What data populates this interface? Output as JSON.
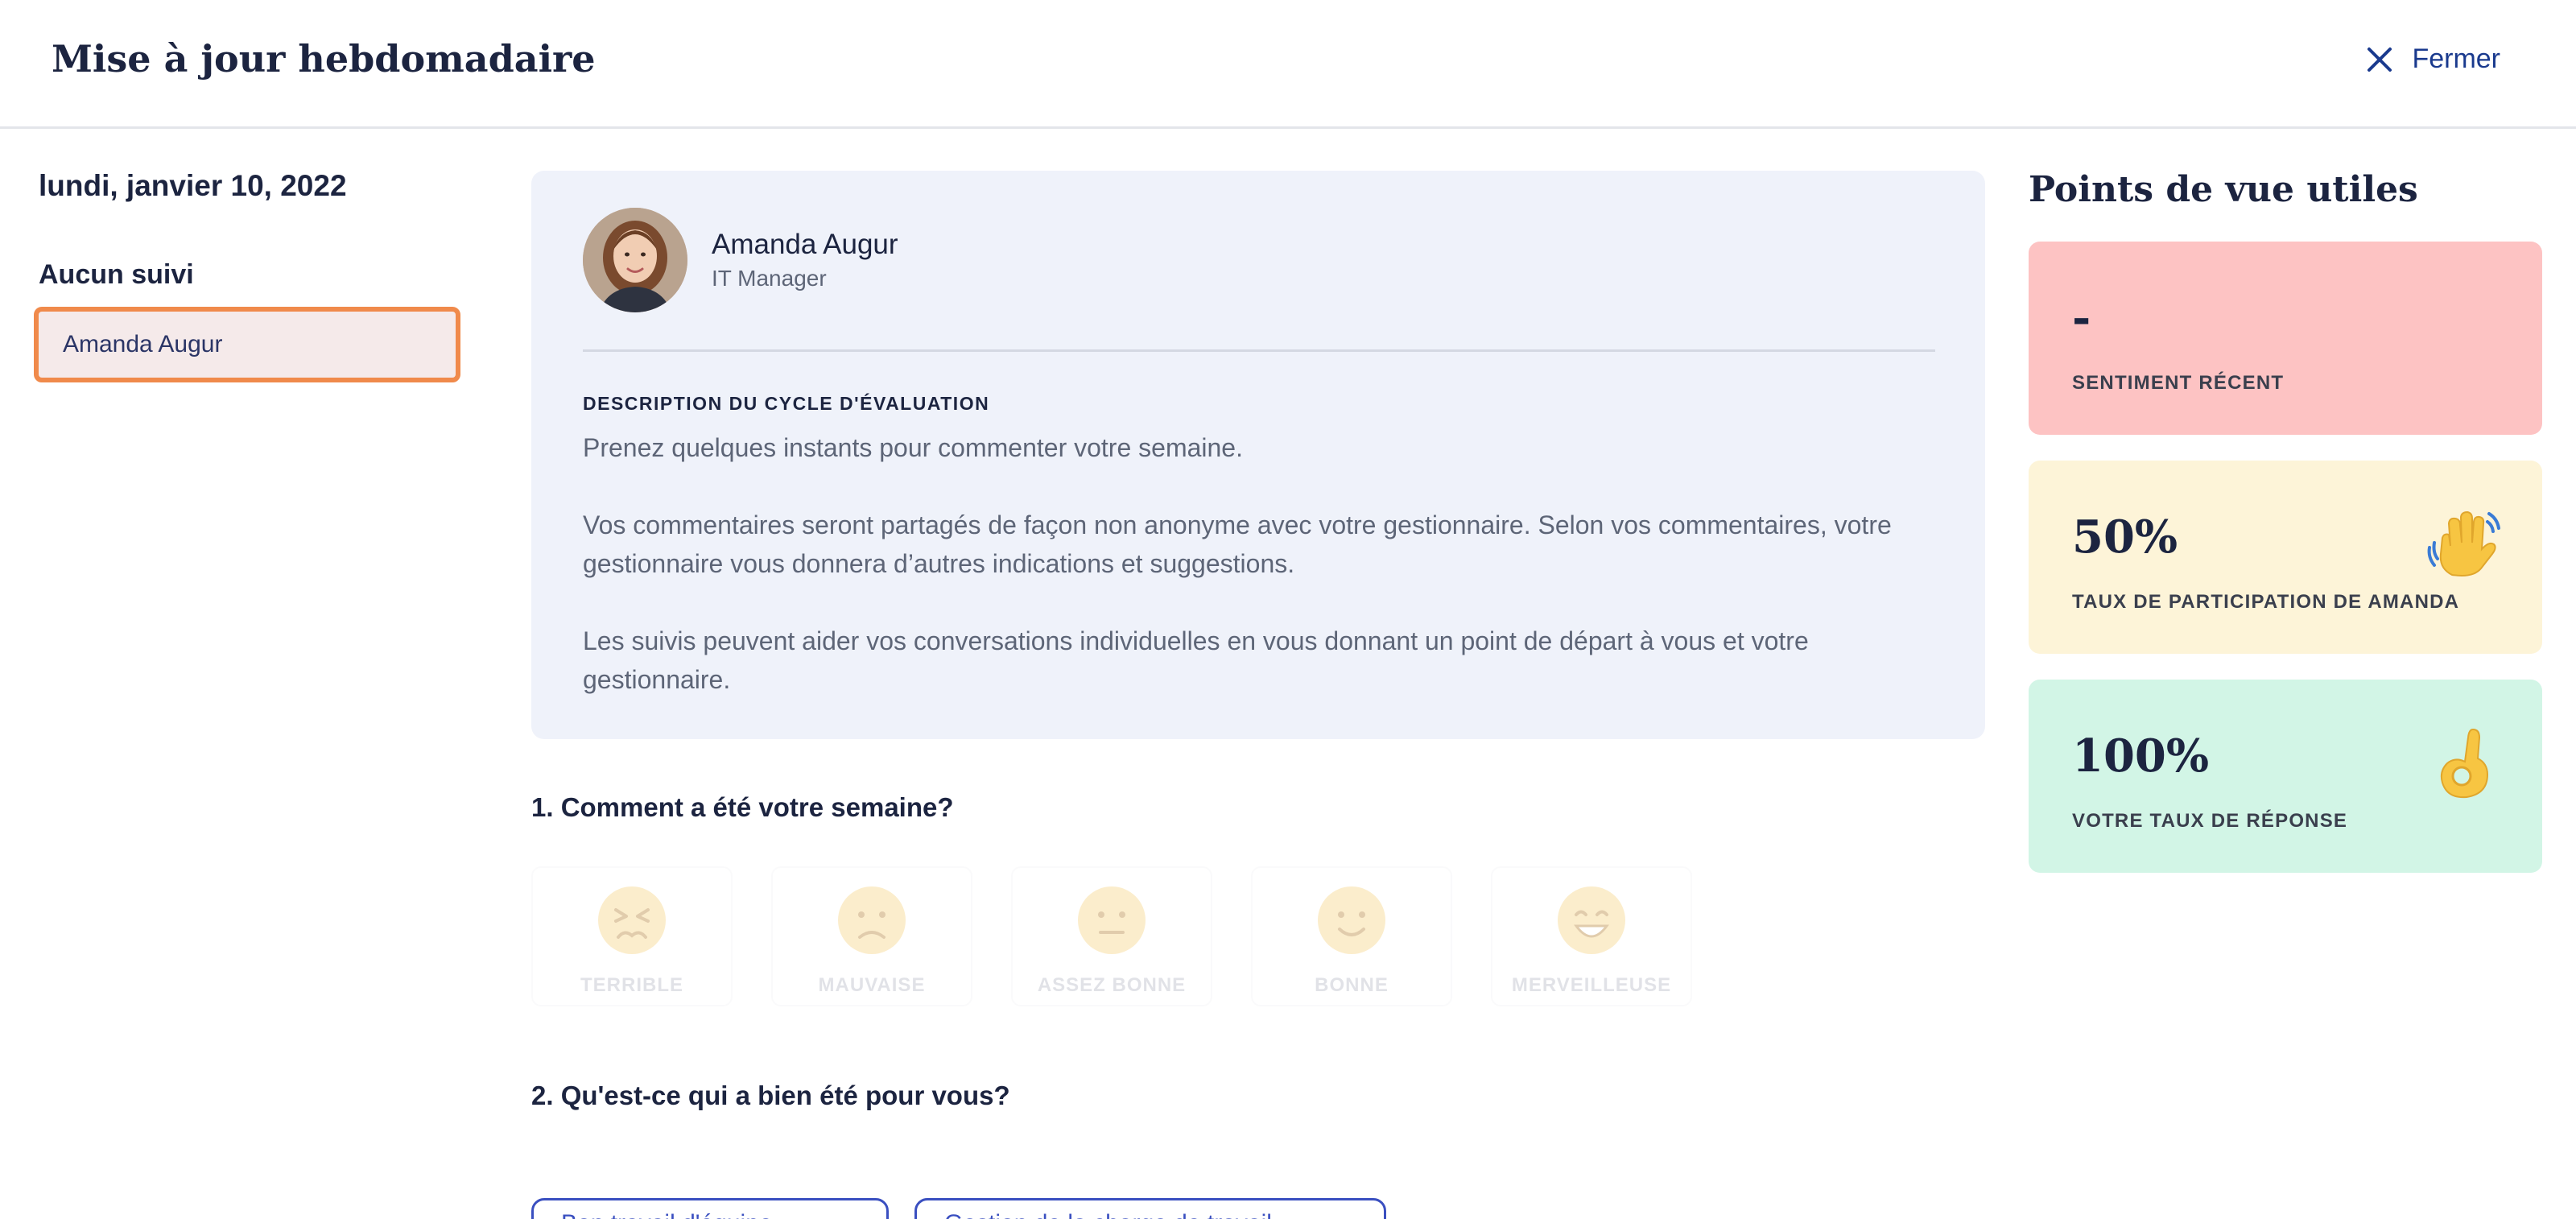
{
  "header": {
    "title": "Mise à jour hebdomadaire",
    "close_label": "Fermer"
  },
  "sidebar": {
    "date": "lundi, janvier 10, 2022",
    "followup_heading": "Aucun suivi",
    "followup_items": [
      {
        "label": "Amanda Augur"
      }
    ]
  },
  "intro": {
    "user_name": "Amanda Augur",
    "user_role": "IT Manager",
    "description_label": "DESCRIPTION DU CYCLE D'ÉVALUATION",
    "paragraphs": [
      "Prenez quelques instants pour commenter votre semaine.",
      "Vos commentaires seront partagés de façon non anonyme avec votre gestionnaire. Selon vos commentaires, votre gestionnaire vous donnera d’autres indications et suggestions.",
      "Les suivis peuvent aider vos conversations individuelles en vous donnant un point de départ à vous et votre gestionnaire."
    ]
  },
  "questions": {
    "q1": "1. Comment a été votre semaine?",
    "q2": "2. Qu'est-ce qui a bien été pour vous?",
    "moods": [
      {
        "label": "TERRIBLE",
        "icon": "face-tired-icon"
      },
      {
        "label": "MAUVAISE",
        "icon": "face-frown-icon"
      },
      {
        "label": "ASSEZ BONNE",
        "icon": "face-neutral-icon"
      },
      {
        "label": "BONNE",
        "icon": "face-smile-icon"
      },
      {
        "label": "MERVEILLEUSE",
        "icon": "face-grin-icon"
      }
    ],
    "chips": [
      {
        "label": "Bon travail d'équipe"
      },
      {
        "label": "Gestion de la charge de travail"
      }
    ]
  },
  "insights": {
    "title": "Points de vue utiles",
    "cards": [
      {
        "value": "-",
        "label": "SENTIMENT RÉCENT",
        "color": "#fdc3c3"
      },
      {
        "value": "50%",
        "label": "TAUX DE PARTICIPATION DE AMANDA",
        "icon": "waving-hand-icon",
        "color": "#fdf4d8"
      },
      {
        "value": "100%",
        "label": "VOTRE TAUX DE RÉPONSE",
        "icon": "ok-hand-icon",
        "color": "#d2f5e6"
      }
    ]
  }
}
